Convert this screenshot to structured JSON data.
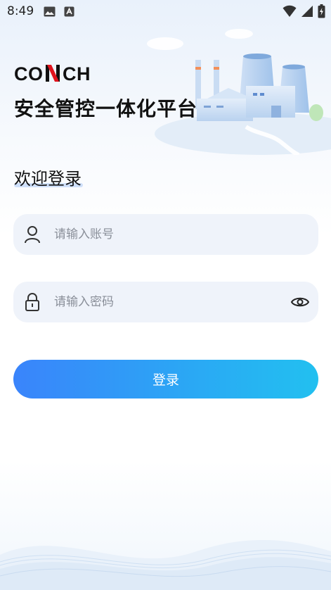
{
  "status_bar": {
    "time": "8:49",
    "left_icons": [
      "image-icon",
      "a-icon"
    ],
    "right_icons": [
      "wifi-icon",
      "signal-icon",
      "battery-icon"
    ]
  },
  "header": {
    "logo_text": "CONCH",
    "app_title": "安全管控一体化平台"
  },
  "welcome": {
    "text": "欢迎登录"
  },
  "form": {
    "username": {
      "placeholder": "请输入账号",
      "value": ""
    },
    "password": {
      "placeholder": "请输入密码",
      "value": ""
    },
    "login_label": "登录"
  },
  "colors": {
    "accent_start": "#3a84fb",
    "accent_end": "#22c0f0",
    "field_bg": "#eff3fa",
    "logo_red": "#e0141e"
  }
}
